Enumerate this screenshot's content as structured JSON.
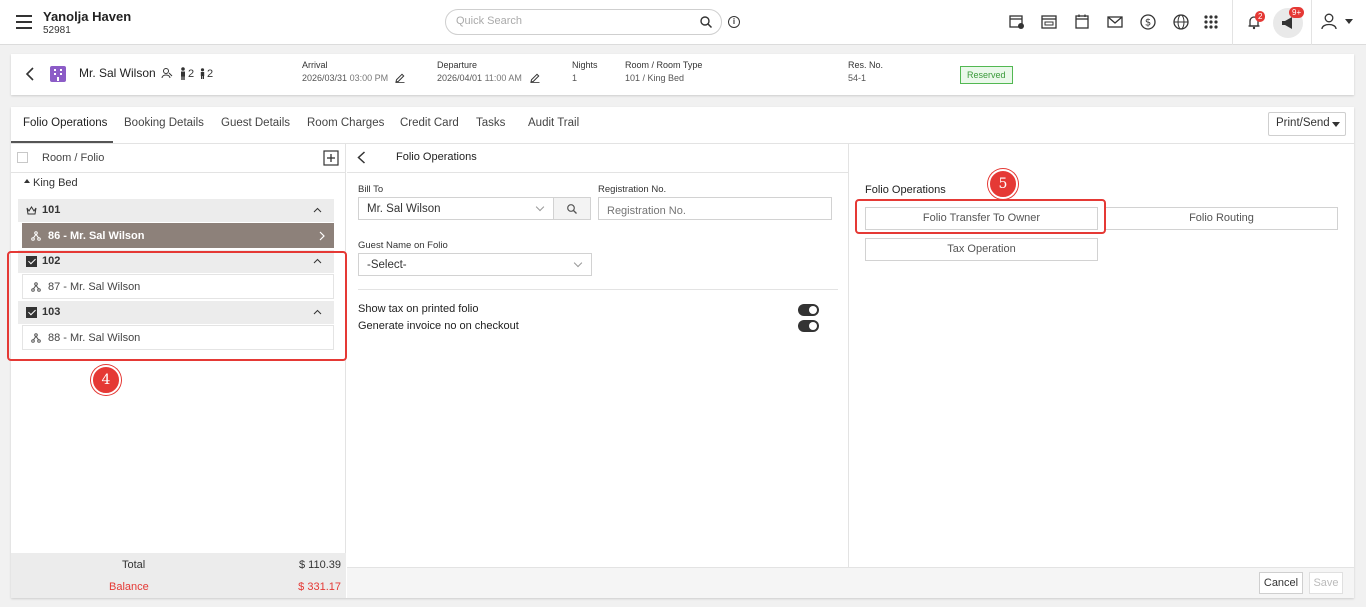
{
  "app": {
    "property_name": "Yanolja Haven",
    "property_id": "52981"
  },
  "search": {
    "placeholder": "Quick Search"
  },
  "notifications": {
    "bell_count": "2",
    "announce_count": "9+"
  },
  "guest": {
    "name": "Mr. Sal Wilson",
    "adults": "2",
    "children": "2",
    "arrival_label": "Arrival",
    "arrival_value": "2026/03/31",
    "arrival_time": "03:00 PM",
    "departure_label": "Departure",
    "departure_value": "2026/04/01",
    "departure_time": "11:00 AM",
    "nights_label": "Nights",
    "nights_value": "1",
    "room_label": "Room / Room Type",
    "room_value": "101 / King Bed",
    "resno_label": "Res. No.",
    "resno_value": "54-1",
    "status": "Reserved"
  },
  "tabs": [
    "Folio Operations",
    "Booking Details",
    "Guest Details",
    "Room Charges",
    "Credit Card",
    "Tasks",
    "Audit Trail"
  ],
  "print_send": "Print/Send",
  "left": {
    "header": "Room / Folio",
    "group": "King Bed",
    "rooms": [
      {
        "room": "101",
        "folio": "86 - Mr. Sal Wilson"
      },
      {
        "room": "102",
        "folio": "87 - Mr. Sal Wilson"
      },
      {
        "room": "103",
        "folio": "88 - Mr. Sal Wilson"
      }
    ],
    "total_label": "Total",
    "total_value": "$ 110.39",
    "balance_label": "Balance",
    "balance_value": "$ 331.17"
  },
  "middle": {
    "title": "Folio Operations",
    "bill_to_label": "Bill To",
    "bill_to_value": "Mr. Sal Wilson",
    "reg_label": "Registration No.",
    "reg_placeholder": "Registration No.",
    "guest_name_label": "Guest Name on Folio",
    "guest_name_value": "-Select-",
    "toggle1_label": "Show tax on printed folio",
    "toggle2_label": "Generate invoice no on checkout"
  },
  "right": {
    "title": "Folio Operations",
    "btn_transfer": "Folio Transfer To Owner",
    "btn_routing": "Folio Routing",
    "btn_tax": "Tax Operation"
  },
  "steps": {
    "left": "4",
    "right": "5"
  },
  "footer": {
    "cancel": "Cancel",
    "save": "Save"
  },
  "colors": {
    "accent_red": "#e53935",
    "selected_row": "#8d817a",
    "balance_red": "#e53935",
    "reserved_green": "#3a9a3a"
  }
}
